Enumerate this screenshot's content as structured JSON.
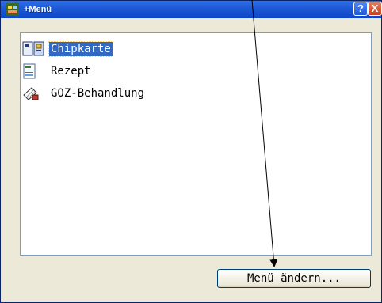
{
  "window": {
    "title": "+Menü"
  },
  "titlebar_buttons": {
    "help": "?",
    "close": "X"
  },
  "list": {
    "items": [
      {
        "label": "Chipkarte",
        "icon": "chipcard-icon",
        "selected": true
      },
      {
        "label": "Rezept",
        "icon": "prescription-icon",
        "selected": false
      },
      {
        "label": "GOZ-Behandlung",
        "icon": "treatment-icon",
        "selected": false
      }
    ]
  },
  "buttons": {
    "change_menu": "Menü ändern..."
  },
  "colors": {
    "titlebar": "#0e45c9",
    "selection": "#316ac5",
    "dialog_bg": "#ece9d8"
  }
}
